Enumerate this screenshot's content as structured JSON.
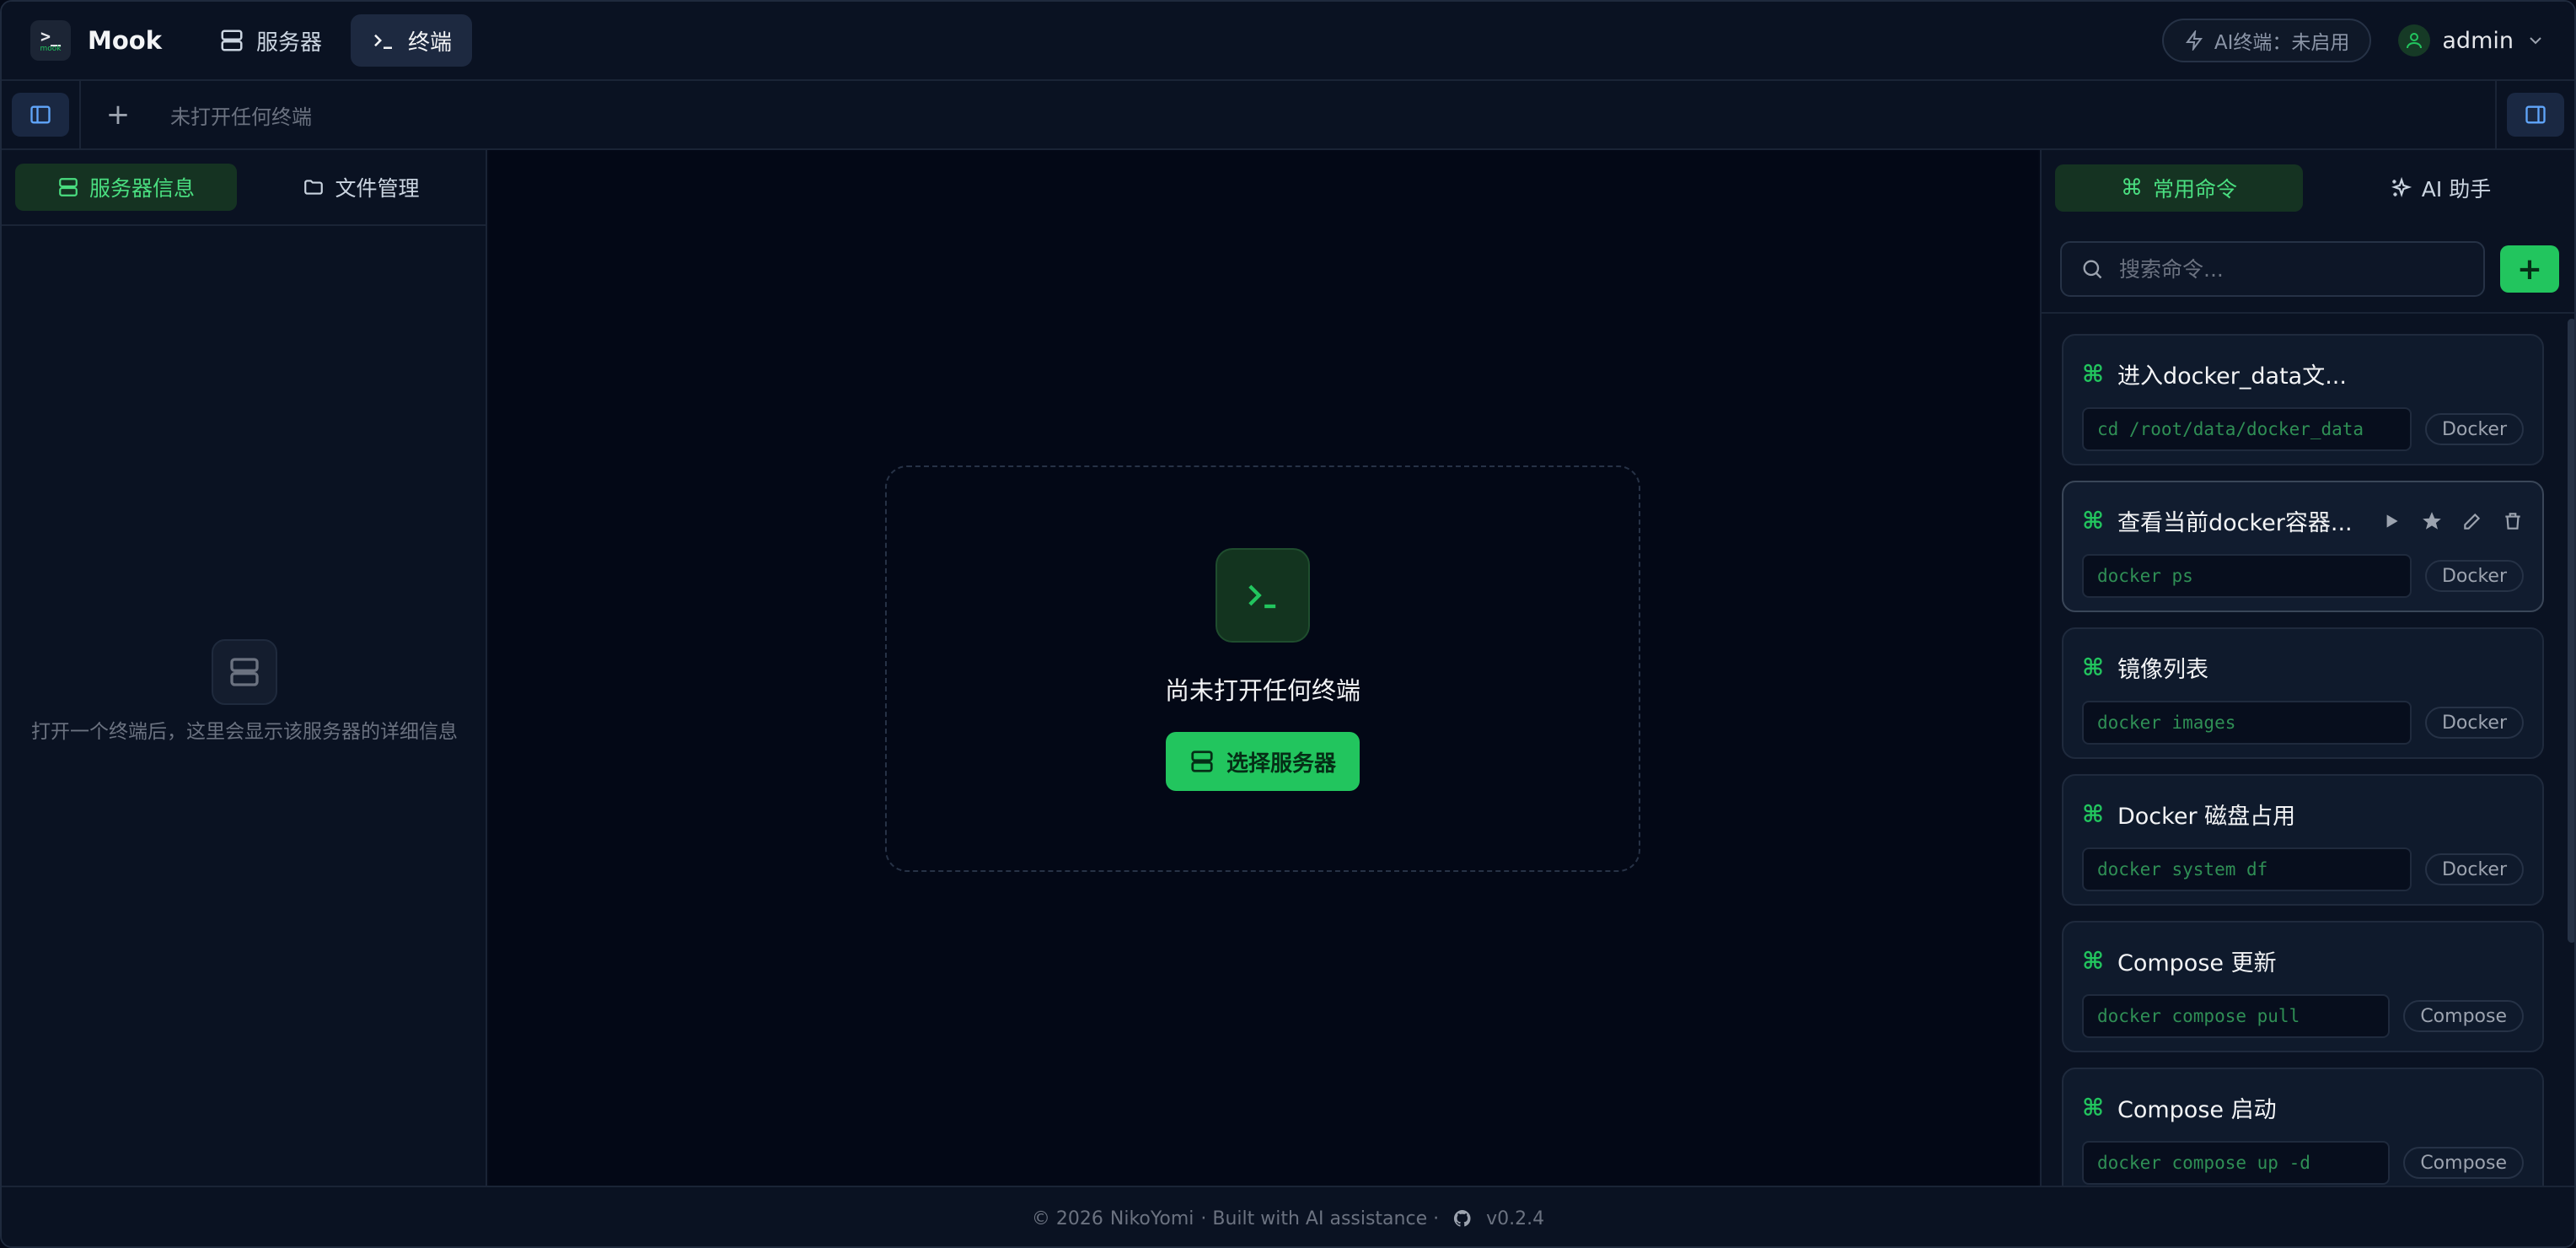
{
  "header": {
    "logo_glyph": ">_",
    "logo_text": "mook",
    "app_name": "Mook",
    "nav": [
      {
        "label": "服务器",
        "icon": "server-icon"
      },
      {
        "label": "终端",
        "icon": "terminal-icon"
      }
    ],
    "ai_status": "AI终端：未启用",
    "user": "admin"
  },
  "tabbar": {
    "add_label": "+",
    "empty_text": "未打开任何终端"
  },
  "left_panel": {
    "tabs": [
      {
        "label": "服务器信息",
        "icon": "server-icon"
      },
      {
        "label": "文件管理",
        "icon": "folder-icon"
      }
    ],
    "empty_text": "打开一个终端后，这里会显示该服务器的详细信息"
  },
  "center": {
    "empty_title": "尚未打开任何终端",
    "select_button": "选择服务器"
  },
  "right_panel": {
    "tabs": [
      {
        "label": "常用命令",
        "icon": "command-icon"
      },
      {
        "label": "AI 助手",
        "icon": "sparkles-icon"
      }
    ],
    "search_placeholder": "搜索命令...",
    "add_button": "+",
    "commands": [
      {
        "name": "进入docker_data文...",
        "code": "cd /root/data/docker_data",
        "tag": "Docker"
      },
      {
        "name": "查看当前docker容器...",
        "code": "docker ps",
        "tag": "Docker"
      },
      {
        "name": "镜像列表",
        "code": "docker images",
        "tag": "Docker"
      },
      {
        "name": "Docker 磁盘占用",
        "code": "docker system df",
        "tag": "Docker"
      },
      {
        "name": "Compose 更新",
        "code": "docker compose pull",
        "tag": "Compose"
      },
      {
        "name": "Compose 启动",
        "code": "docker compose up -d",
        "tag": "Compose"
      }
    ]
  },
  "footer": {
    "copyright": "© 2026",
    "author": "NikoYomi",
    "built": "· Built with AI assistance ·",
    "version": "v0.2.4"
  },
  "colors": {
    "accent": "#22c55e",
    "background": "#050a18",
    "panel": "#0a1222"
  }
}
